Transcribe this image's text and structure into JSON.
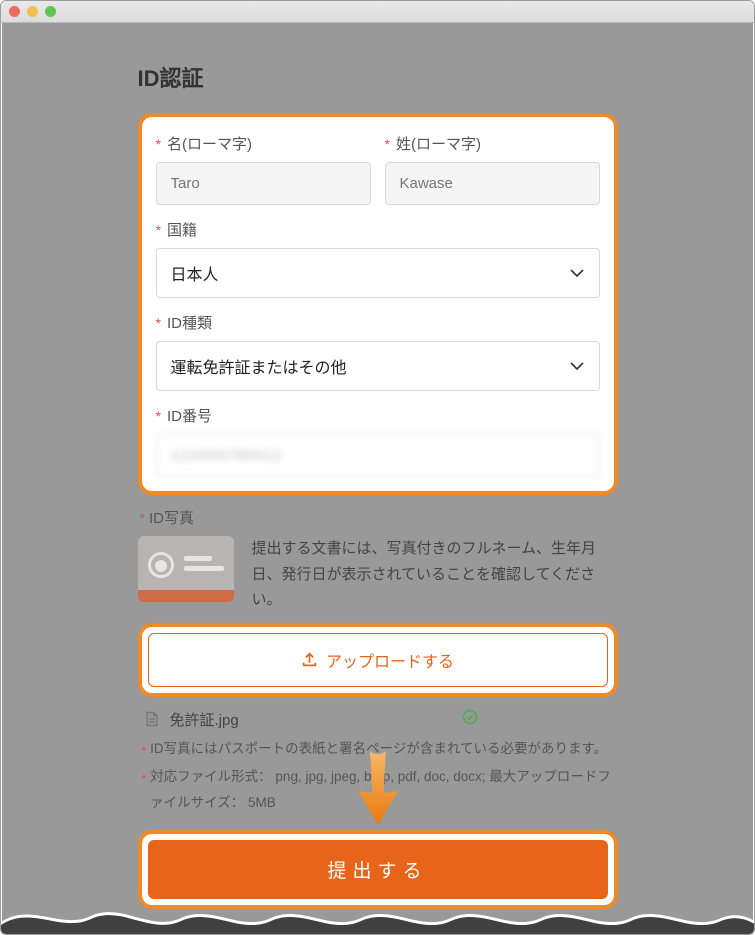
{
  "page": {
    "title": "ID認証"
  },
  "form": {
    "first_name": {
      "label": "名(ローマ字)",
      "placeholder": "Taro"
    },
    "last_name": {
      "label": "姓(ローマ字)",
      "placeholder": "Kawase"
    },
    "nationality": {
      "label": "国籍",
      "value": "日本人"
    },
    "id_type": {
      "label": "ID種類",
      "value": "運転免許証またはその他"
    },
    "id_number": {
      "label": "ID番号",
      "value_masked": "123456789012"
    },
    "id_photo": {
      "label": "ID写真",
      "description": "提出する文書には、写真付きのフルネーム、生年月日、発行日が表示されていることを確認してください。"
    },
    "upload_button": "アップロードする",
    "uploaded_file": {
      "name": "免許証.jpg",
      "status": "ok"
    },
    "note_passport": "ID写真にはパスポートの表紙と署名ページが含まれている必要があります。",
    "note_formats": "対応ファイル形式： png, jpg, jpeg, bmp, pdf, doc, docx; 最大アップロードファイルサイズ： 5MB",
    "submit_button": "提出する"
  }
}
